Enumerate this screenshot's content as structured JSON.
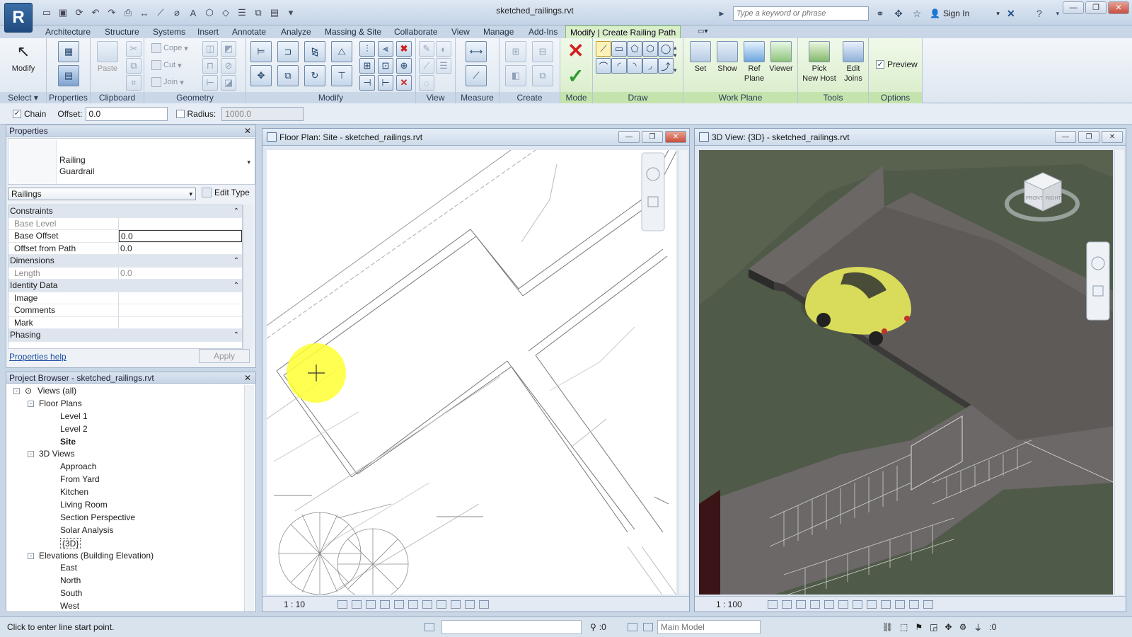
{
  "app": {
    "logo": "R",
    "title": "sketched_railings.rvt"
  },
  "search": {
    "placeholder": "Type a keyword or phrase"
  },
  "user": {
    "sign_in": "Sign In"
  },
  "ribbon_tabs": [
    "Architecture",
    "Structure",
    "Systems",
    "Insert",
    "Annotate",
    "Analyze",
    "Massing & Site",
    "Collaborate",
    "View",
    "Manage",
    "Add-Ins",
    "Modify | Create Railing Path"
  ],
  "ribbon_panels": {
    "select": "Select",
    "properties": "Properties",
    "clipboard": "Clipboard",
    "geometry": "Geometry",
    "modify": "Modify",
    "view": "View",
    "measure": "Measure",
    "create": "Create",
    "mode": "Mode",
    "draw": "Draw",
    "work_plane": "Work Plane",
    "tools": "Tools",
    "options": "Options"
  },
  "ribbon_buttons": {
    "modify": "Modify",
    "paste": "Paste",
    "cope": "Cope",
    "cut": "Cut",
    "join": "Join",
    "set": "Set",
    "show": "Show",
    "ref_plane_1": "Ref",
    "ref_plane_2": "Plane",
    "viewer": "Viewer",
    "pick_new_host_1": "Pick",
    "pick_new_host_2": "New Host",
    "edit_joins_1": "Edit",
    "edit_joins_2": "Joins",
    "preview": "Preview"
  },
  "options_bar": {
    "chain_label": "Chain",
    "chain_checked": true,
    "offset_label": "Offset:",
    "offset_value": "0.0",
    "radius_label": "Radius:",
    "radius_checked": false,
    "radius_value": "1000.0"
  },
  "properties": {
    "title": "Properties",
    "type_family": "Railing",
    "type_name": "Guardrail",
    "category_filter": "Railings",
    "edit_type": "Edit Type",
    "rows": [
      {
        "kind": "group",
        "name": "Constraints"
      },
      {
        "kind": "prop",
        "name": "Base Level",
        "value": "",
        "dim": true
      },
      {
        "kind": "prop",
        "name": "Base Offset",
        "value": "0.0",
        "editing": true
      },
      {
        "kind": "prop",
        "name": "Offset from Path",
        "value": "0.0"
      },
      {
        "kind": "group",
        "name": "Dimensions"
      },
      {
        "kind": "prop",
        "name": "Length",
        "value": "0.0",
        "dim": true
      },
      {
        "kind": "group",
        "name": "Identity Data"
      },
      {
        "kind": "prop",
        "name": "Image",
        "value": ""
      },
      {
        "kind": "prop",
        "name": "Comments",
        "value": ""
      },
      {
        "kind": "prop",
        "name": "Mark",
        "value": ""
      },
      {
        "kind": "group",
        "name": "Phasing"
      }
    ],
    "help_link": "Properties help",
    "apply": "Apply"
  },
  "project_browser": {
    "title": "Project Browser - sketched_railings.rvt",
    "tree": [
      {
        "level": 0,
        "label": "Views (all)",
        "toggle": "-"
      },
      {
        "level": 1,
        "label": "Floor Plans",
        "toggle": "-"
      },
      {
        "level": 2,
        "label": "Level 1"
      },
      {
        "level": 2,
        "label": "Level 2"
      },
      {
        "level": 2,
        "label": "Site",
        "bold": true
      },
      {
        "level": 1,
        "label": "3D Views",
        "toggle": "-"
      },
      {
        "level": 2,
        "label": "Approach"
      },
      {
        "level": 2,
        "label": "From Yard"
      },
      {
        "level": 2,
        "label": "Kitchen"
      },
      {
        "level": 2,
        "label": "Living Room"
      },
      {
        "level": 2,
        "label": "Section Perspective"
      },
      {
        "level": 2,
        "label": "Solar Analysis"
      },
      {
        "level": 2,
        "label": "{3D}",
        "boxed": true
      },
      {
        "level": 1,
        "label": "Elevations (Building Elevation)",
        "toggle": "-"
      },
      {
        "level": 2,
        "label": "East"
      },
      {
        "level": 2,
        "label": "North"
      },
      {
        "level": 2,
        "label": "South"
      },
      {
        "level": 2,
        "label": "West"
      }
    ]
  },
  "floor_plan_view": {
    "title": "Floor Plan: Site - sketched_railings.rvt",
    "scale": "1 : 10"
  },
  "view_3d": {
    "title": "3D View: {3D} - sketched_railings.rvt",
    "scale": "1 : 100",
    "viewcube_front": "FRONT",
    "viewcube_right": "RIGHT"
  },
  "status": {
    "prompt": "Click to enter line start point.",
    "worksets_count": ":0",
    "model": "Main Model",
    "filter_count": ":0"
  },
  "colors": {
    "ribbon_context": "#d8f0c8",
    "cursor_highlight": "#ffff33",
    "car": "#d9dc5a",
    "ground_dark": "#4e4c4b",
    "grass": "#505a49"
  }
}
